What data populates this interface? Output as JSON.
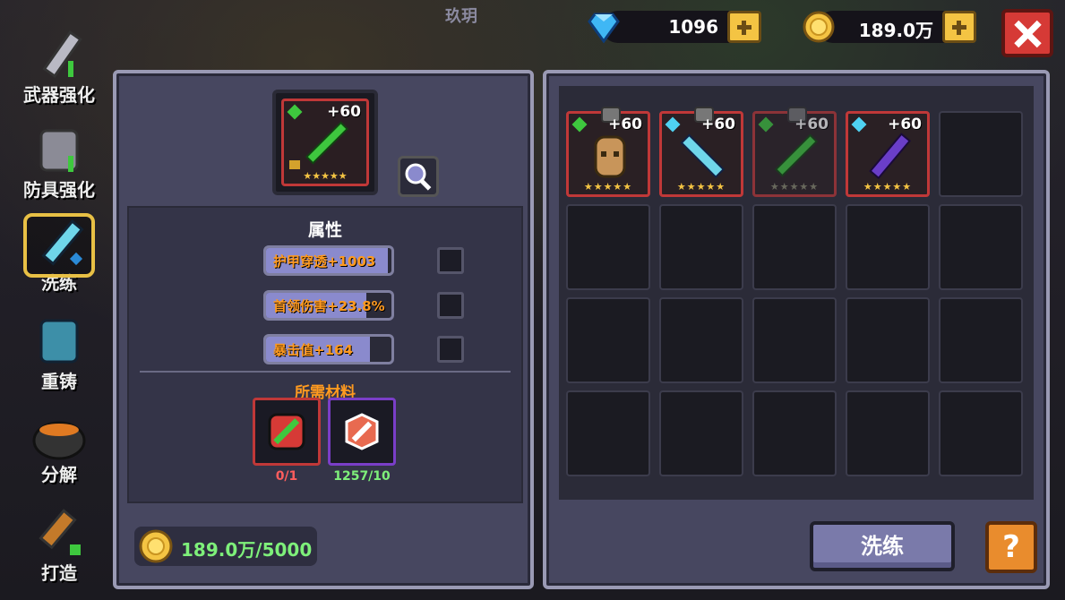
{
  "top": {
    "title": "玖玥",
    "diamonds": "1096",
    "gold": "189.0万"
  },
  "nav": [
    {
      "label": "武器强化"
    },
    {
      "label": "防具强化"
    },
    {
      "label": "洗练"
    },
    {
      "label": "重铸"
    },
    {
      "label": "分解"
    },
    {
      "label": "打造"
    }
  ],
  "item": {
    "level": "+60",
    "stars": "★★★★★"
  },
  "attributes": {
    "title": "属性",
    "stats": [
      {
        "text": "护甲穿透+1003",
        "fill": 0.97
      },
      {
        "text": "首领伤害+23.8%",
        "fill": 0.8
      },
      {
        "text": "暴击值+164",
        "fill": 0.83
      }
    ]
  },
  "materials": {
    "title": "所需材料",
    "items": [
      {
        "count": "0/1"
      },
      {
        "count": "1257/10"
      }
    ]
  },
  "cost": "189.0万/5000",
  "grid": {
    "items": [
      {
        "level": "+60",
        "stars": "★★★★★"
      },
      {
        "level": "+60",
        "stars": "★★★★★"
      },
      {
        "level": "+60",
        "stars": "★★★★★"
      },
      {
        "level": "+60",
        "stars": "★★★★★"
      }
    ]
  },
  "buttons": {
    "refine": "洗练",
    "help": "?"
  },
  "colors": {
    "accent_orange": "#ff9a1f",
    "gold": "#f4c443",
    "green_text": "#7ef07a",
    "slot_border_red": "#c03838"
  }
}
